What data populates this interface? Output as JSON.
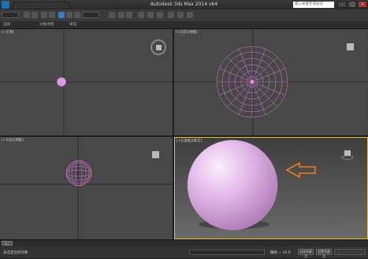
{
  "titlebar": {
    "title": "Autodesk 3ds Max  2014 x64",
    "search_placeholder": "键入关键字或短语"
  },
  "ribbon": {
    "tabs": [
      "选择",
      "对象绘制",
      "填充"
    ]
  },
  "viewports": {
    "top_left": {
      "label": "[+][顶]"
    },
    "top_right": {
      "label": "[+][前][线框]"
    },
    "bottom_left": {
      "label": "[+][左][线框]"
    },
    "bottom_right": {
      "label": "[+][透视][真实]"
    }
  },
  "timeline": {
    "frame": "0 / 100"
  },
  "status": {
    "selection": "未选定任何对象",
    "grid": "栅格 = 10.0",
    "autokey": "自动关键点",
    "setkey": "设置关键点"
  },
  "colors": {
    "sphere_pink": "#d99adf",
    "wire_pink": "#e07ae0",
    "arrow_orange": "#f07a1e",
    "active_border": "#e8c23a"
  }
}
